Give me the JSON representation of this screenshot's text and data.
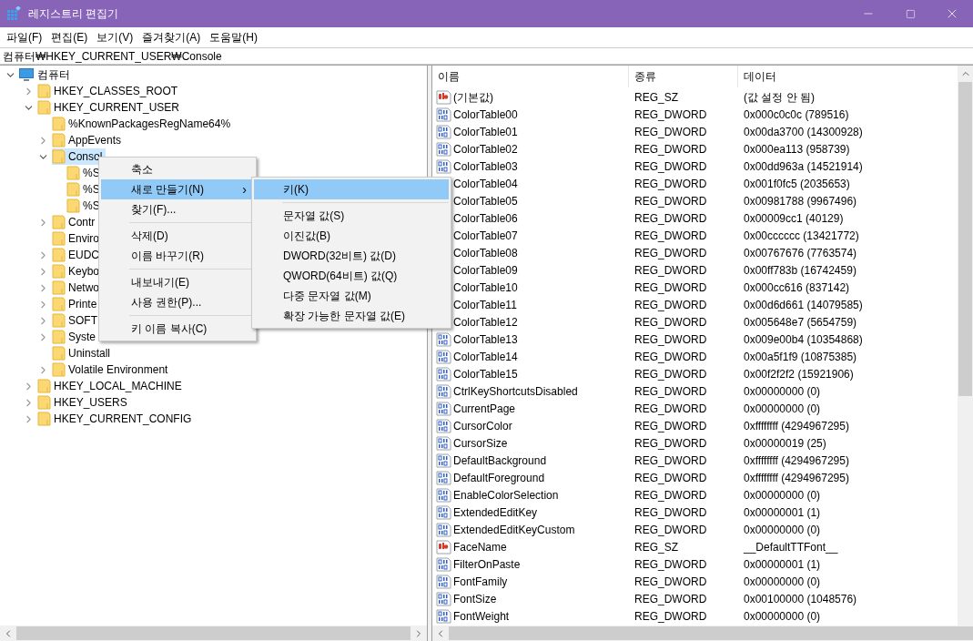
{
  "window": {
    "title": "레지스트리 편집기"
  },
  "menu_bar": [
    "파일(F)",
    "편집(E)",
    "보기(V)",
    "즐겨찾기(A)",
    "도움말(H)"
  ],
  "address": "컴퓨터₩HKEY_CURRENT_USER₩Console",
  "tree": {
    "label": "컴퓨터",
    "expanded": true,
    "selected": false,
    "children": [
      {
        "label": "HKEY_CLASSES_ROOT",
        "expanded": false,
        "selected": false
      },
      {
        "label": "HKEY_CURRENT_USER",
        "expanded": true,
        "selected": false,
        "children": [
          {
            "label": "%KnownPackagesRegName64%",
            "selected": false
          },
          {
            "label": "AppEvents",
            "expanded": false,
            "selected": false
          },
          {
            "label": "Consol",
            "expanded": true,
            "selected": true,
            "children": [
              {
                "label": "%S",
                "selected": false
              },
              {
                "label": "%S",
                "selected": false
              },
              {
                "label": "%S",
                "selected": false
              }
            ]
          },
          {
            "label": "Contr",
            "expanded": false,
            "selected": false
          },
          {
            "label": "Enviro",
            "selected": false
          },
          {
            "label": "EUDC",
            "expanded": false,
            "selected": false
          },
          {
            "label": "Keybo",
            "expanded": false,
            "selected": false
          },
          {
            "label": "Netwo",
            "expanded": false,
            "selected": false
          },
          {
            "label": "Printe",
            "expanded": false,
            "selected": false
          },
          {
            "label": "SOFT",
            "expanded": false,
            "selected": false
          },
          {
            "label": "Syste",
            "expanded": false,
            "selected": false
          },
          {
            "label": "Uninstall",
            "selected": false
          },
          {
            "label": "Volatile Environment",
            "expanded": false,
            "selected": false
          }
        ]
      },
      {
        "label": "HKEY_LOCAL_MACHINE",
        "expanded": false,
        "selected": false
      },
      {
        "label": "HKEY_USERS",
        "expanded": false,
        "selected": false
      },
      {
        "label": "HKEY_CURRENT_CONFIG",
        "expanded": false,
        "selected": false
      }
    ]
  },
  "values": {
    "columns": [
      "이름",
      "종류",
      "데이터"
    ],
    "rows": [
      {
        "kind": "string",
        "name": "(기본값)",
        "type": "REG_SZ",
        "data": "(값 설정 안 됨)"
      },
      {
        "kind": "dword",
        "name": "ColorTable00",
        "type": "REG_DWORD",
        "data": "0x000c0c0c (789516)"
      },
      {
        "kind": "dword",
        "name": "ColorTable01",
        "type": "REG_DWORD",
        "data": "0x00da3700 (14300928)"
      },
      {
        "kind": "dword",
        "name": "ColorTable02",
        "type": "REG_DWORD",
        "data": "0x000ea113 (958739)"
      },
      {
        "kind": "dword",
        "name": "ColorTable03",
        "type": "REG_DWORD",
        "data": "0x00dd963a (14521914)"
      },
      {
        "icon_covered": true,
        "name": "ColorTable04",
        "type": "REG_DWORD",
        "data": "0x001f0fc5 (2035653)"
      },
      {
        "icon_covered": true,
        "name": "ColorTable05",
        "type": "REG_DWORD",
        "data": "0x00981788 (9967496)"
      },
      {
        "icon_covered": true,
        "name": "ColorTable06",
        "type": "REG_DWORD",
        "data": "0x00009cc1 (40129)"
      },
      {
        "icon_covered": true,
        "name": "ColorTable07",
        "type": "REG_DWORD",
        "data": "0x00cccccc (13421772)"
      },
      {
        "icon_covered": true,
        "name": "ColorTable08",
        "type": "REG_DWORD",
        "data": "0x00767676 (7763574)"
      },
      {
        "icon_covered": true,
        "name": "ColorTable09",
        "type": "REG_DWORD",
        "data": "0x00ff783b (16742459)"
      },
      {
        "icon_covered": true,
        "name": "ColorTable10",
        "type": "REG_DWORD",
        "data": "0x000cc616 (837142)"
      },
      {
        "icon_covered": true,
        "name": "ColorTable11",
        "type": "REG_DWORD",
        "data": "0x00d6d661 (14079585)"
      },
      {
        "icon_covered": true,
        "name": "ColorTable12",
        "type": "REG_DWORD",
        "data": "0x005648e7 (5654759)"
      },
      {
        "kind": "dword",
        "name": "ColorTable13",
        "type": "REG_DWORD",
        "data": "0x009e00b4 (10354868)"
      },
      {
        "kind": "dword",
        "name": "ColorTable14",
        "type": "REG_DWORD",
        "data": "0x00a5f1f9 (10875385)"
      },
      {
        "kind": "dword",
        "name": "ColorTable15",
        "type": "REG_DWORD",
        "data": "0x00f2f2f2 (15921906)"
      },
      {
        "kind": "dword",
        "name": "CtrlKeyShortcutsDisabled",
        "type": "REG_DWORD",
        "data": "0x00000000 (0)"
      },
      {
        "kind": "dword",
        "name": "CurrentPage",
        "type": "REG_DWORD",
        "data": "0x00000000 (0)"
      },
      {
        "kind": "dword",
        "name": "CursorColor",
        "type": "REG_DWORD",
        "data": "0xffffffff (4294967295)"
      },
      {
        "kind": "dword",
        "name": "CursorSize",
        "type": "REG_DWORD",
        "data": "0x00000019 (25)"
      },
      {
        "kind": "dword",
        "name": "DefaultBackground",
        "type": "REG_DWORD",
        "data": "0xffffffff (4294967295)"
      },
      {
        "kind": "dword",
        "name": "DefaultForeground",
        "type": "REG_DWORD",
        "data": "0xffffffff (4294967295)"
      },
      {
        "kind": "dword",
        "name": "EnableColorSelection",
        "type": "REG_DWORD",
        "data": "0x00000000 (0)"
      },
      {
        "kind": "dword",
        "name": "ExtendedEditKey",
        "type": "REG_DWORD",
        "data": "0x00000001 (1)"
      },
      {
        "kind": "dword",
        "name": "ExtendedEditKeyCustom",
        "type": "REG_DWORD",
        "data": "0x00000000 (0)"
      },
      {
        "kind": "string",
        "name": "FaceName",
        "type": "REG_SZ",
        "data": "__DefaultTTFont__"
      },
      {
        "kind": "dword",
        "name": "FilterOnPaste",
        "type": "REG_DWORD",
        "data": "0x00000001 (1)"
      },
      {
        "kind": "dword",
        "name": "FontFamily",
        "type": "REG_DWORD",
        "data": "0x00000000 (0)"
      },
      {
        "kind": "dword",
        "name": "FontSize",
        "type": "REG_DWORD",
        "data": "0x00100000 (1048576)"
      },
      {
        "kind": "dword",
        "name": "FontWeight",
        "type": "REG_DWORD",
        "data": "0x00000000 (0)"
      }
    ]
  },
  "context_menu": {
    "items": [
      {
        "kind": "item",
        "label": "축소",
        "selected": false
      },
      {
        "kind": "submenu",
        "label": "새로 만들기(N)",
        "arrow": "›",
        "selected": true
      },
      {
        "kind": "item",
        "label": "찾기(F)...",
        "selected": false
      },
      {
        "kind": "separator"
      },
      {
        "kind": "item",
        "label": "삭제(D)",
        "selected": false
      },
      {
        "kind": "item",
        "label": "이름 바꾸기(R)",
        "selected": false
      },
      {
        "kind": "separator"
      },
      {
        "kind": "item",
        "label": "내보내기(E)",
        "selected": false
      },
      {
        "kind": "item",
        "label": "사용 권한(P)...",
        "selected": false
      },
      {
        "kind": "separator"
      },
      {
        "kind": "item",
        "label": "키 이름 복사(C)",
        "selected": false
      }
    ]
  },
  "submenu": {
    "items": [
      {
        "kind": "item",
        "label": "키(K)",
        "selected": true
      },
      {
        "kind": "separator"
      },
      {
        "kind": "item",
        "label": "문자열 값(S)",
        "selected": false
      },
      {
        "kind": "item",
        "label": "이진값(B)",
        "selected": false
      },
      {
        "kind": "item",
        "label": "DWORD(32비트) 값(D)",
        "selected": false
      },
      {
        "kind": "item",
        "label": "QWORD(64비트) 값(Q)",
        "selected": false
      },
      {
        "kind": "item",
        "label": "다중 문자열 값(M)",
        "selected": false
      },
      {
        "kind": "item",
        "label": "확장 가능한 문자열 값(E)",
        "selected": false
      }
    ]
  }
}
